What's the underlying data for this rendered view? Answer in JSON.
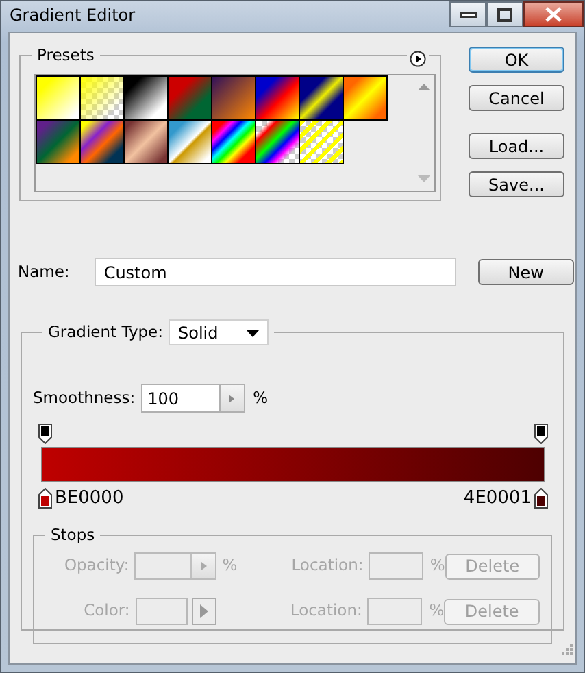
{
  "window": {
    "title": "Gradient Editor"
  },
  "presets": {
    "label": "Presets"
  },
  "buttons": [
    {
      "label": "OK",
      "default": true
    },
    {
      "label": "Cancel",
      "default": false
    },
    {
      "label": "Load...",
      "default": false
    },
    {
      "label": "Save...",
      "default": false
    }
  ],
  "name": {
    "label": "Name:",
    "value": "Custom",
    "button": "New"
  },
  "gradient": {
    "type_label": "Gradient Type:",
    "type_value": "Solid",
    "smoothness_label": "Smoothness:",
    "smoothness_value": "100",
    "smoothness_unit": "%",
    "color_stops": [
      {
        "label": "BE0000",
        "color": "#be0000"
      },
      {
        "label": "4E0001",
        "color": "#4e0001"
      }
    ]
  },
  "stops": {
    "title": "Stops",
    "rows": [
      {
        "kind": "stepper",
        "label": "Opacity:",
        "unit": "%",
        "location_label": "Location:",
        "location_unit": "%",
        "button": "Delete",
        "disabled": true
      },
      {
        "kind": "swatch",
        "label": "Color:",
        "location_label": "Location:",
        "location_unit": "%",
        "button": "Delete",
        "disabled": true
      }
    ]
  }
}
